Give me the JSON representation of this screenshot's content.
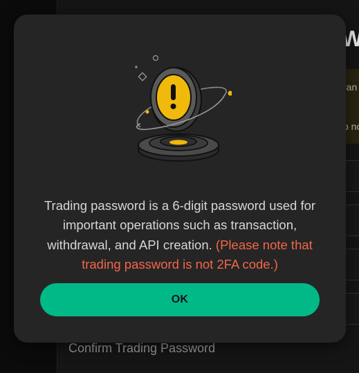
{
  "background": {
    "heading_fragment": "W",
    "notice_fragment_1": "ran",
    "notice_fragment_2": "o no",
    "confirm_label": "Confirm Trading Password"
  },
  "modal": {
    "illustration_icon": "warning-coin-icon",
    "message": "Trading password is a 6-digit password used for important operations such as transaction, withdrawal, and API creation. ",
    "note": "(Please note that trading password is not 2FA code.)",
    "ok_label": "OK"
  },
  "colors": {
    "modal_bg": "#252525",
    "accent_green": "#00b987",
    "note_red": "#f2664a",
    "coin_yellow": "#f0b90b"
  }
}
